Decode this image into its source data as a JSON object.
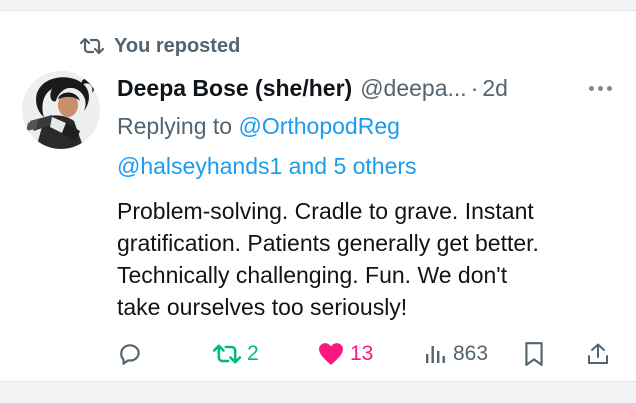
{
  "repost_banner": {
    "text": "You reposted",
    "icon": "repost-icon"
  },
  "tweet": {
    "display_name": "Deepa Bose (she/her)",
    "handle": "@deepa...",
    "separator": "·",
    "time": "2d",
    "more_icon": "more-dots-icon",
    "replying_prefix": "Replying to",
    "reply_to_primary": "@OrthopodReg",
    "reply_to_secondary": "@halseyhands1 and 5 others",
    "text_lines": [
      "Problem-solving. Cradle to grave. Instant",
      "gratification. Patients generally get better.",
      "Technically challenging. Fun. We don't",
      "take ourselves too seriously!"
    ]
  },
  "actions": {
    "reply": {
      "icon": "reply-icon"
    },
    "repost": {
      "icon": "repost-icon",
      "count": "2",
      "color": "#00ba7c"
    },
    "like": {
      "icon": "heart-icon",
      "count": "13",
      "color": "#f91880"
    },
    "views": {
      "icon": "views-icon",
      "count": "863"
    },
    "bookmark": {
      "icon": "bookmark-icon"
    },
    "share": {
      "icon": "share-icon"
    }
  },
  "colors": {
    "link": "#1d9bf0",
    "secondary_text": "#536471",
    "primary_text": "#0f1419"
  }
}
